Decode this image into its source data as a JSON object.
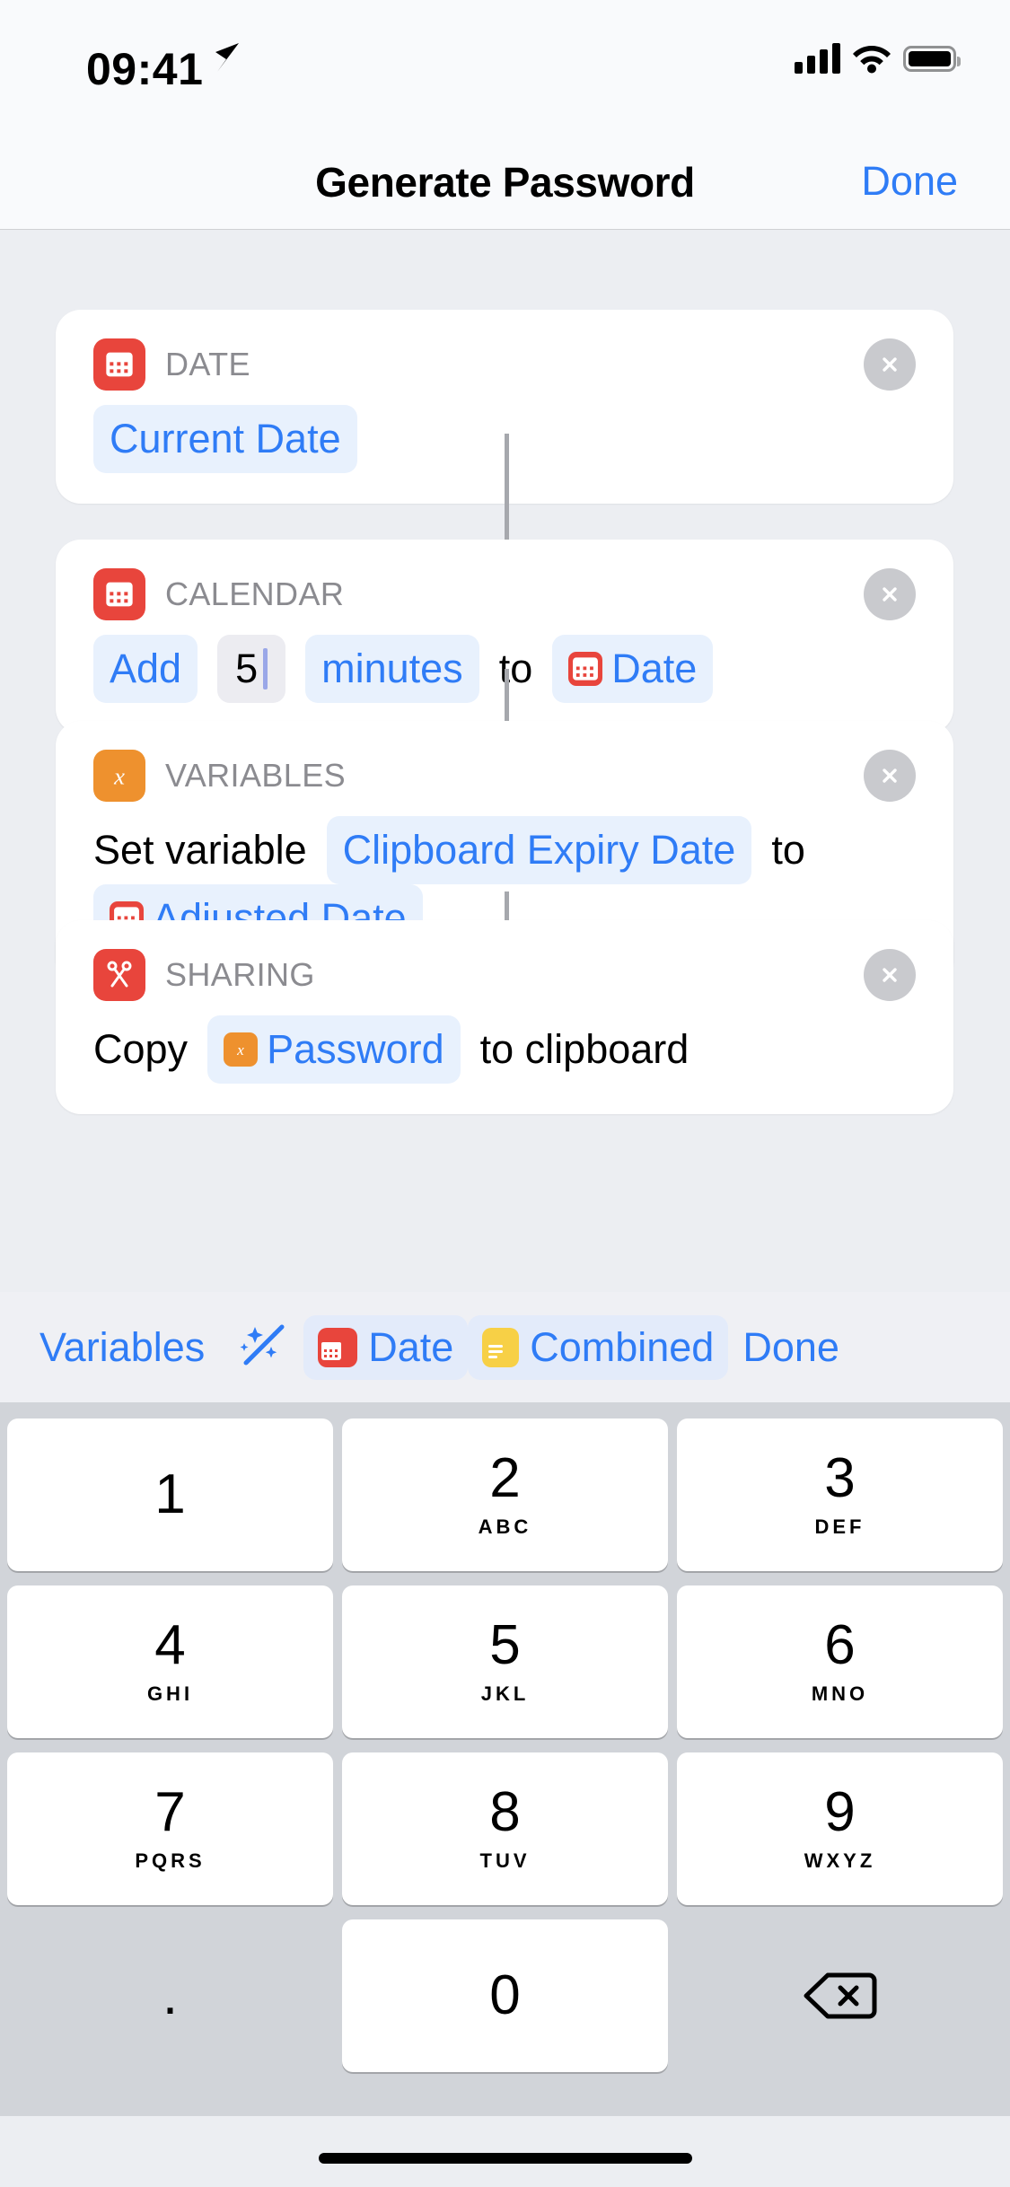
{
  "status_bar": {
    "time": "09:41",
    "location_icon": "location-arrow-icon",
    "cellular_icon": "signal-bars-icon",
    "wifi_icon": "wifi-icon",
    "battery_icon": "battery-full-icon"
  },
  "nav": {
    "title": "Generate Password",
    "done_label": "Done"
  },
  "actions": [
    {
      "category": "DATE",
      "icon": "calendar-icon",
      "icon_color": "#e8453c",
      "parts": [
        {
          "kind": "pill",
          "text": "Current Date"
        }
      ]
    },
    {
      "category": "CALENDAR",
      "icon": "calendar-icon",
      "icon_color": "#e8453c",
      "parts": [
        {
          "kind": "pill",
          "text": "Add"
        },
        {
          "kind": "field",
          "text": "5"
        },
        {
          "kind": "pill",
          "text": "minutes"
        },
        {
          "kind": "text",
          "text": "to"
        },
        {
          "kind": "pill",
          "text": "Date",
          "icon": "calendar-icon",
          "icon_color": "#e8453c"
        }
      ]
    },
    {
      "category": "VARIABLES",
      "icon": "variable-x-icon",
      "icon_color": "#ee912e",
      "parts": [
        {
          "kind": "text",
          "text": "Set variable"
        },
        {
          "kind": "pill",
          "text": "Clipboard Expiry Date"
        },
        {
          "kind": "text",
          "text": "to"
        },
        {
          "kind": "pill",
          "text": "Adjusted Date",
          "icon": "calendar-icon",
          "icon_color": "#e8453c"
        }
      ]
    },
    {
      "category": "SHARING",
      "icon": "scissors-icon",
      "icon_color": "#e8453c",
      "parts": [
        {
          "kind": "text",
          "text": "Copy"
        },
        {
          "kind": "pill",
          "text": "Password",
          "icon": "variable-x-icon",
          "icon_color": "#ee912e"
        },
        {
          "kind": "text",
          "text": "to clipboard"
        }
      ]
    }
  ],
  "close_button_label": "close-icon",
  "keyboard_toolbar": {
    "variables_label": "Variables",
    "magic_icon": "magic-wand-icon",
    "date_label": "Date",
    "date_icon": "calendar-icon",
    "combined_label": "Combined",
    "combined_icon": "text-lines-icon",
    "done_label": "Done"
  },
  "keypad": {
    "keys": [
      {
        "num": "1",
        "sub": ""
      },
      {
        "num": "2",
        "sub": "ABC"
      },
      {
        "num": "3",
        "sub": "DEF"
      },
      {
        "num": "4",
        "sub": "GHI"
      },
      {
        "num": "5",
        "sub": "JKL"
      },
      {
        "num": "6",
        "sub": "MNO"
      },
      {
        "num": "7",
        "sub": "PQRS"
      },
      {
        "num": "8",
        "sub": "TUV"
      },
      {
        "num": "9",
        "sub": "WXYZ"
      }
    ],
    "decimal": ".",
    "zero": "0",
    "delete_icon": "delete-backward-icon"
  },
  "colors": {
    "accent_blue": "#2f7cf6",
    "red": "#e8453c",
    "orange": "#ee912e",
    "yellow": "#f7d046",
    "page_bg": "#eceef2",
    "keyboard_bg": "#d1d4d9"
  }
}
